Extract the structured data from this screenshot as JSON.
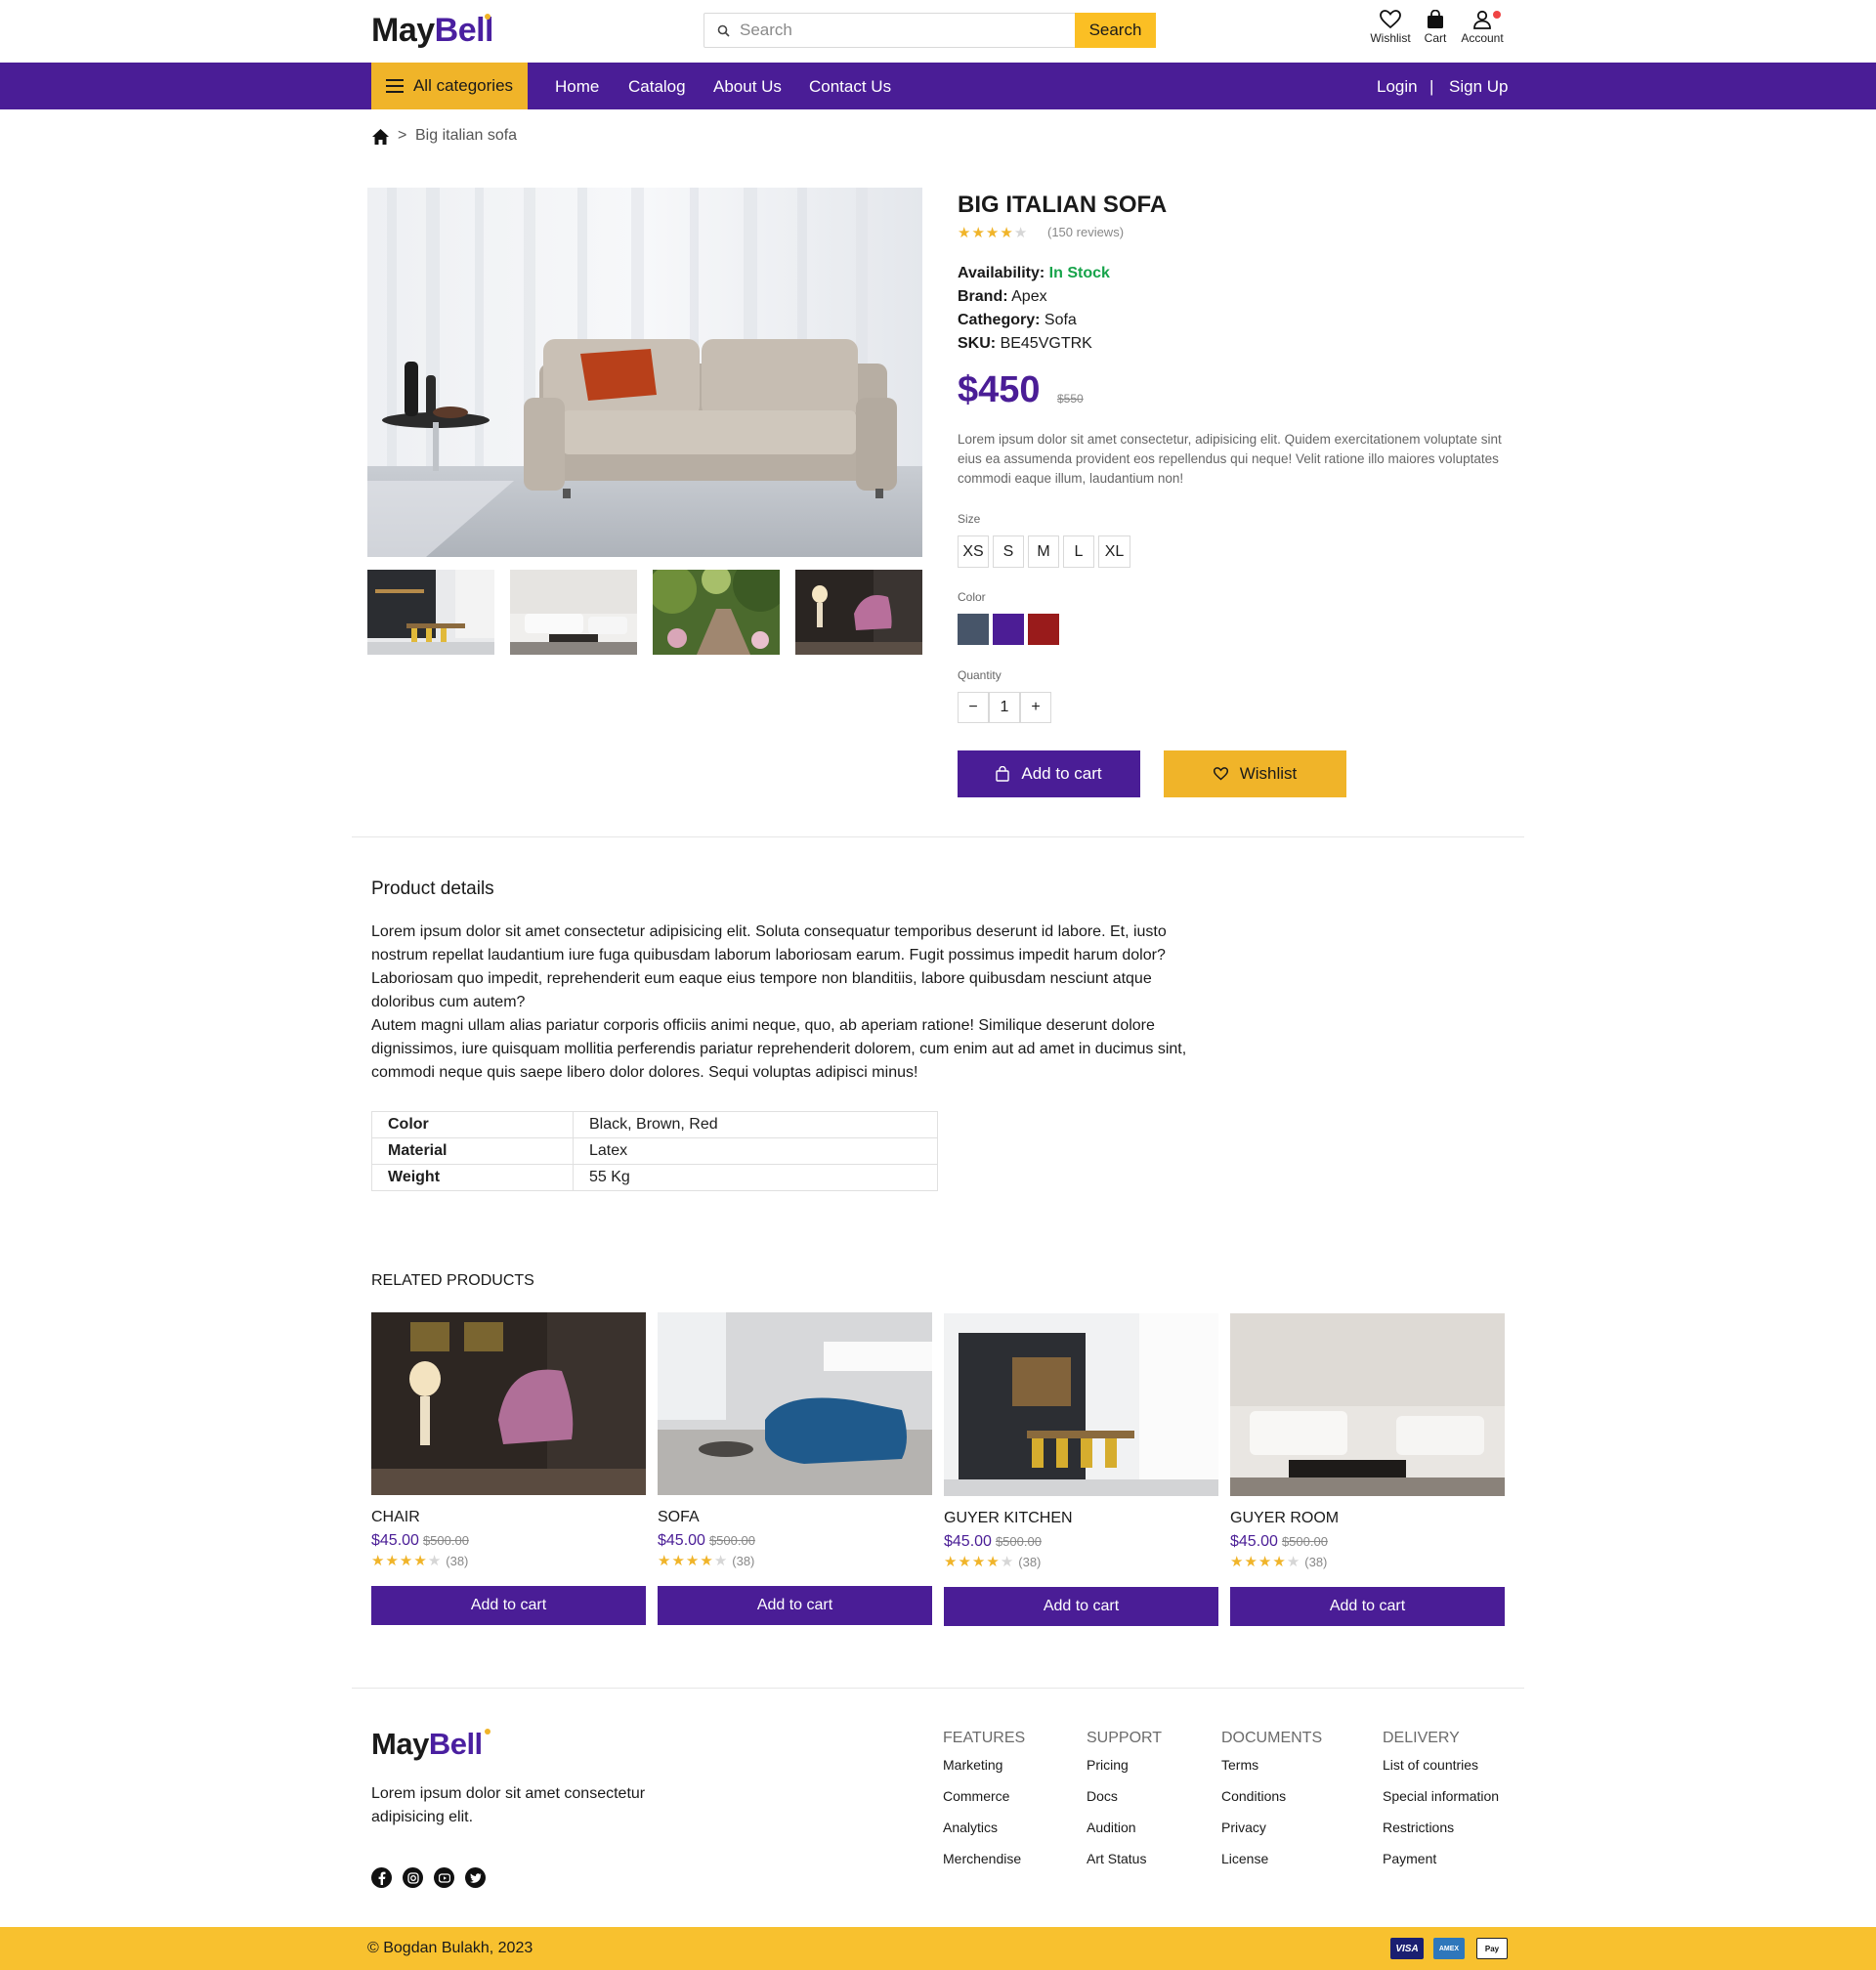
{
  "brand": {
    "name_part1": "May",
    "name_part2": "Bell"
  },
  "header": {
    "search_placeholder": "Search",
    "search_button": "Search",
    "wishlist_label": "Wishlist",
    "cart_label": "Cart",
    "account_label": "Account"
  },
  "nav": {
    "all_categories": "All categories",
    "links": [
      "Home",
      "Catalog",
      "About Us",
      "Contact Us"
    ],
    "login": "Login",
    "separator": "|",
    "signup": "Sign Up"
  },
  "breadcrumb": {
    "separator": ">",
    "current": "Big italian sofa"
  },
  "product": {
    "title": "BIG ITALIAN SOFA",
    "rating": 4,
    "reviews_text": "(150 reviews)",
    "availability_label": "Availability:",
    "availability_value": "In Stock",
    "brand_label": "Brand:",
    "brand_value": "Apex",
    "category_label": "Cathegory:",
    "category_value": "Sofa",
    "sku_label": "SKU:",
    "sku_value": "BE45VGTRK",
    "price": "$450",
    "old_price": "$550",
    "description": "Lorem ipsum dolor sit amet consectetur, adipisicing elit. Quidem exercitationem voluptate sint eius ea assumenda provident eos repellendus qui neque! Velit ratione illo maiores voluptates commodi eaque illum, laudantium non!",
    "size_label": "Size",
    "sizes": [
      "XS",
      "S",
      "M",
      "L",
      "XL"
    ],
    "color_label": "Color",
    "colors": [
      "#475569",
      "#4c1d95",
      "#991b1b"
    ],
    "quantity_label": "Quantity",
    "quantity_minus": "−",
    "quantity_value": "1",
    "quantity_plus": "+",
    "add_to_cart": "Add to cart",
    "wishlist": "Wishlist"
  },
  "details": {
    "heading": "Product details",
    "paragraph1": "Lorem ipsum dolor sit amet consectetur adipisicing elit. Soluta consequatur temporibus deserunt id labore. Et, iusto nostrum repellat laudantium iure fuga quibusdam laborum laboriosam earum. Fugit possimus impedit harum dolor? Laboriosam quo impedit, reprehenderit eum eaque eius tempore non blanditiis, labore quibusdam nesciunt atque doloribus cum autem?",
    "paragraph2": "Autem magni ullam alias pariatur corporis officiis animi neque, quo, ab aperiam ratione! Similique deserunt dolore dignissimos, iure quisquam mollitia perferendis pariatur reprehenderit dolorem, cum enim aut ad amet in ducimus sint, commodi neque quis saepe libero dolor dolores. Sequi voluptas adipisci minus!",
    "specs": [
      {
        "key": "Color",
        "value": "Black, Brown, Red"
      },
      {
        "key": "Material",
        "value": "Latex"
      },
      {
        "key": "Weight",
        "value": "55 Kg"
      }
    ]
  },
  "related": {
    "heading": "RELATED PRODUCTS",
    "items": [
      {
        "name": "CHAIR",
        "price": "$45.00",
        "old_price": "$500.00",
        "rating": 4,
        "count": "(38)",
        "button": "Add to cart"
      },
      {
        "name": "SOFA",
        "price": "$45.00",
        "old_price": "$500.00",
        "rating": 4,
        "count": "(38)",
        "button": "Add to cart"
      },
      {
        "name": "GUYER KITCHEN",
        "price": "$45.00",
        "old_price": "$500.00",
        "rating": 4,
        "count": "(38)",
        "button": "Add to cart"
      },
      {
        "name": "GUYER ROOM",
        "price": "$45.00",
        "old_price": "$500.00",
        "rating": 4,
        "count": "(38)",
        "button": "Add to cart"
      }
    ]
  },
  "footer": {
    "tagline": "Lorem ipsum dolor sit amet consectetur adipisicing elit.",
    "columns": [
      {
        "heading": "FEATURES",
        "links": [
          "Marketing",
          "Commerce",
          "Analytics",
          "Merchendise"
        ]
      },
      {
        "heading": "SUPPORT",
        "links": [
          "Pricing",
          "Docs",
          "Audition",
          "Art Status"
        ]
      },
      {
        "heading": "DOCUMENTS",
        "links": [
          "Terms",
          "Conditions",
          "Privacy",
          "License"
        ]
      },
      {
        "heading": "DELIVERY",
        "links": [
          "List of countries",
          "Special information",
          "Restrictions",
          "Payment"
        ]
      }
    ],
    "copyright": "© Bogdan Bulakh, 2023",
    "payments": [
      "VISA",
      "AMEX",
      "Pay"
    ]
  },
  "theme": {
    "primary": "#4a1d96",
    "accent": "#f0b429",
    "in_stock": "#16a34a"
  }
}
